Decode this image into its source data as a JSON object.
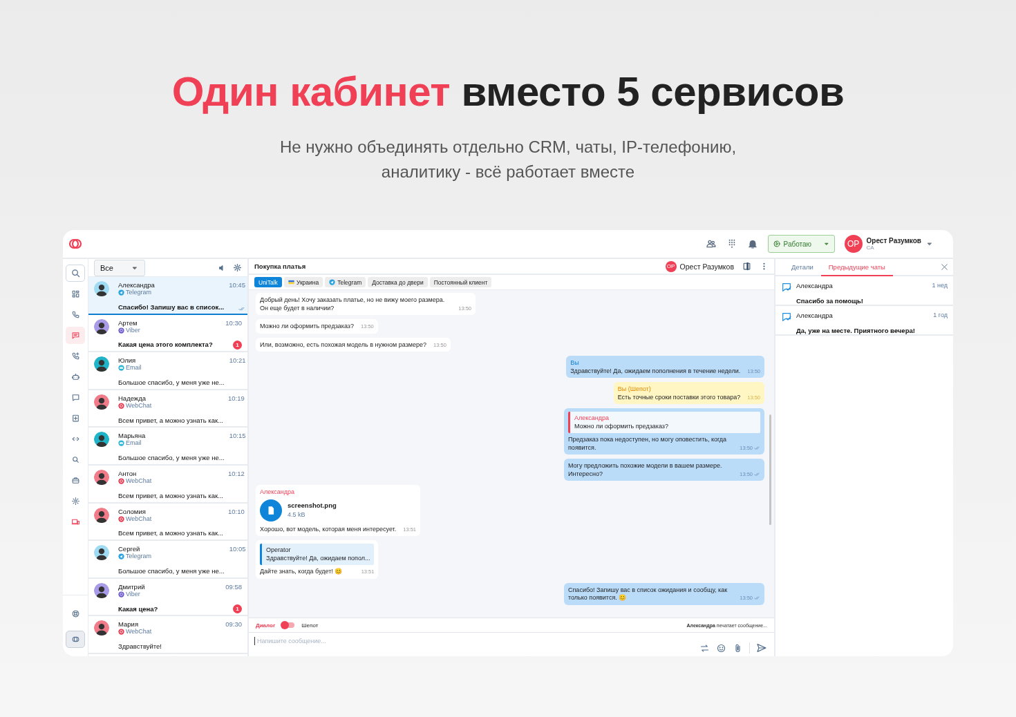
{
  "headline": "*Один кабинет* вместо 5 сервисов",
  "subtitle": "Не нужно объединять отдельно CRM, чаты, IP-телефонию, аналитику - всё работает вместе",
  "topbar": {
    "status": "Работаю",
    "user": {
      "initials": "OP",
      "name": "Орест Разумков",
      "role": "CA"
    }
  },
  "rail": {
    "items": [
      {
        "kind": "search",
        "selected": false
      },
      {
        "kind": "grid",
        "selected": false
      },
      {
        "kind": "phone",
        "selected": false
      },
      {
        "kind": "chat",
        "selected": true
      },
      {
        "kind": "phone-plus",
        "selected": false
      },
      {
        "kind": "robot",
        "selected": false
      },
      {
        "kind": "message",
        "selected": false
      },
      {
        "kind": "plus-square",
        "selected": false
      },
      {
        "kind": "code",
        "selected": false
      },
      {
        "kind": "search-small",
        "selected": false
      },
      {
        "kind": "briefcase",
        "selected": false
      },
      {
        "kind": "gear",
        "selected": false
      },
      {
        "kind": "device",
        "selected": false
      }
    ],
    "bottom": [
      {
        "kind": "lifebuoy"
      },
      {
        "kind": "logo"
      }
    ]
  },
  "chat_list": {
    "filter": "Все",
    "chats": [
      {
        "name": "Александра",
        "kind": "telegram",
        "channel": "Telegram",
        "time": "10:45",
        "preview": "Спасибо! Запишу вас в список...",
        "unread": true,
        "read": true,
        "selected": true,
        "color": "#9fdcf3"
      },
      {
        "name": "Артем",
        "kind": "viber",
        "channel": "Viber",
        "time": "10:30",
        "preview": "Какая цена этого комплекта?",
        "unread": true,
        "badge": "1",
        "read": false,
        "selected": false,
        "color": "#a99be8"
      },
      {
        "name": "Юлия",
        "kind": "email",
        "channel": "Email",
        "time": "10:21",
        "preview": "Большое спасибо, у меня уже не...",
        "unread": false,
        "read": false,
        "selected": false,
        "color": "#20b4c8"
      },
      {
        "name": "Надежда",
        "kind": "webchat",
        "channel": "WebChat",
        "time": "10:19",
        "preview": "Всем привет, а можно узнать как...",
        "unread": false,
        "read": false,
        "selected": false,
        "color": "#f27b8a"
      },
      {
        "name": "Марьяна",
        "kind": "email",
        "channel": "Email",
        "time": "10:15",
        "preview": "Большое спасибо, у меня уже не...",
        "unread": false,
        "read": false,
        "selected": false,
        "color": "#20b4c8"
      },
      {
        "name": "Антон",
        "kind": "webchat",
        "channel": "WebChat",
        "time": "10:12",
        "preview": "Всем привет, а можно узнать как...",
        "unread": false,
        "read": false,
        "selected": false,
        "color": "#f27b8a"
      },
      {
        "name": "Соломия",
        "kind": "webchat",
        "channel": "WebChat",
        "time": "10:10",
        "preview": "Всем привет, а можно узнать как...",
        "unread": false,
        "read": false,
        "selected": false,
        "color": "#f27b8a"
      },
      {
        "name": "Сергей",
        "kind": "telegram",
        "channel": "Telegram",
        "time": "10:05",
        "preview": "Большое спасибо, у меня уже не...",
        "unread": false,
        "read": false,
        "selected": false,
        "color": "#9fdcf3"
      },
      {
        "name": "Дмитрий",
        "kind": "viber",
        "channel": "Viber",
        "time": "09:58",
        "preview": "Какая цена?",
        "unread": true,
        "badge": "1",
        "read": false,
        "selected": false,
        "color": "#a99be8"
      },
      {
        "name": "Мария",
        "kind": "webchat",
        "channel": "WebChat",
        "time": "09:30",
        "preview": "Здравствуйте!",
        "unread": false,
        "read": false,
        "selected": false,
        "color": "#f27b8a"
      }
    ]
  },
  "chat": {
    "title": "Покупка платья",
    "operator": {
      "initials": "OP",
      "name": "Орест Разумков"
    },
    "tags": [
      {
        "label": "UniTalk",
        "kind": "plain",
        "selected": true
      },
      {
        "label": "Украина",
        "kind": "flag",
        "selected": false
      },
      {
        "label": "Telegram",
        "kind": "telegram",
        "selected": false
      },
      {
        "label": "Доставка до двери",
        "kind": "plain",
        "selected": false
      },
      {
        "label": "Постоянный клиент",
        "kind": "plain",
        "selected": false
      }
    ],
    "messages": [
      {
        "kind": "in",
        "text": "Добрый день! Хочу заказать платье, но не вижу моего размера. Он еще будет в наличии?",
        "time": "13:50"
      },
      {
        "kind": "in",
        "text": "Можно ли оформить предзаказ?",
        "time": "13:50"
      },
      {
        "kind": "in",
        "text": "Или, возможно, есть похожая модель в нужном размере?",
        "time": "13:50"
      },
      {
        "kind": "out",
        "author": "Вы",
        "text": "Здравствуйте! Да, ожидаем пополнения в течение недели.",
        "time": "13:50",
        "read": false
      },
      {
        "kind": "whisper",
        "author": "Вы (Шепот)",
        "text": "Есть точные сроки поставки этого товара?",
        "time": "13:50"
      },
      {
        "kind": "out",
        "quote": {
          "author": "Александра",
          "text": "Можно ли оформить предзаказ?"
        },
        "text": "Предзаказ пока недоступен, но могу оповестить, когда появится.",
        "time": "13:50",
        "read": true
      },
      {
        "kind": "out",
        "text": "Могу предложить похожие модели в вашем размере. Интересно?",
        "time": "13:50",
        "read": true
      },
      {
        "kind": "in",
        "author": "Александра",
        "file": {
          "name": "screenshot.png",
          "size": "4.5 kB"
        },
        "text": "Хорошо, вот модель, которая меня интересует.",
        "time": "13:51"
      },
      {
        "kind": "in",
        "quote": {
          "author": "Operator",
          "text": "Здравствуйте! Да, ожидаем попол..."
        },
        "text": "Дайте знать, когда будет! 😊",
        "time": "13:51"
      },
      {
        "kind": "out",
        "text": "Спасибо! Запишу вас в список ожидания и сообщу, как только появится. 😊",
        "time": "13:50",
        "read": true
      }
    ],
    "composer": {
      "mode_dialog": "Диалог",
      "mode_whisper": "Шепот",
      "whisper": false,
      "typing": "**Александра** печатает сообщение...",
      "placeholder": "Напишите сообщение..."
    }
  },
  "details": {
    "tabs": [
      {
        "label": "Детали",
        "selected": false
      },
      {
        "label": "Предыдущие чаты",
        "selected": true
      }
    ],
    "items": [
      {
        "name": "Александра",
        "time": "1 нед",
        "text": "Спасибо за помощь!"
      },
      {
        "name": "Александра",
        "time": "1 год",
        "text": "Да, уже на месте. Приятного вечера!"
      }
    ]
  }
}
